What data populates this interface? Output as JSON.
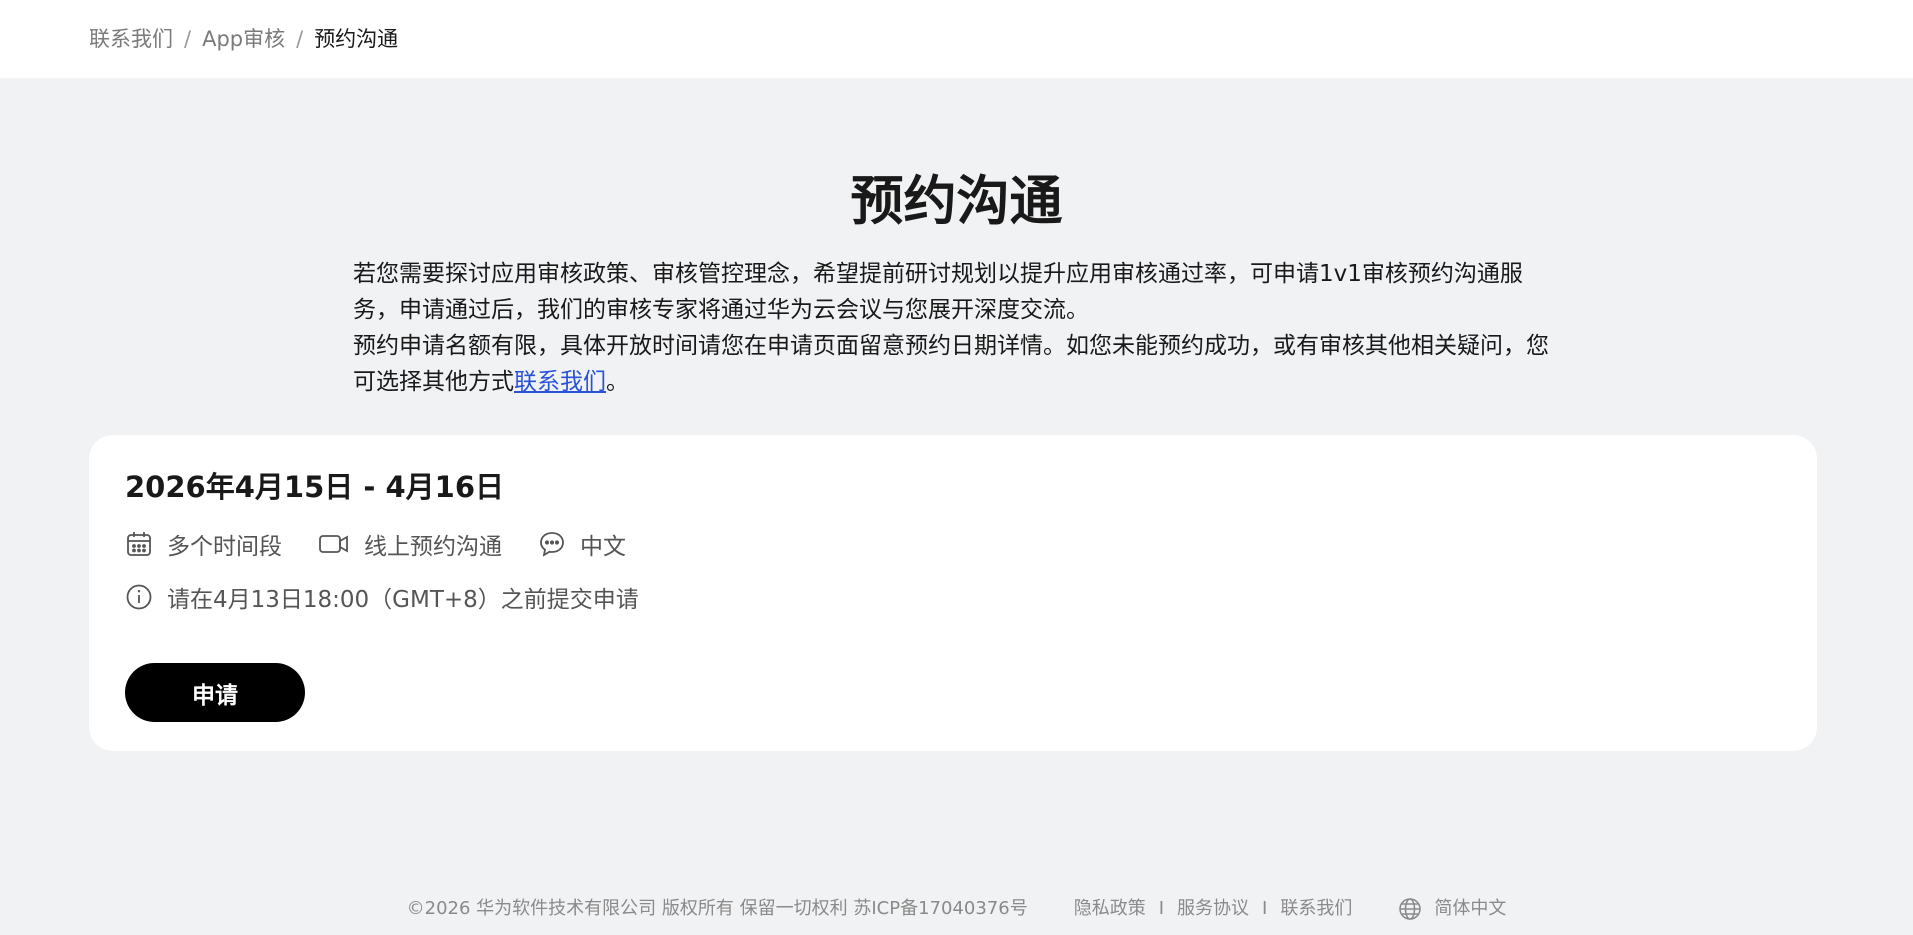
{
  "breadcrumb": {
    "items": [
      "联系我们",
      "App审核"
    ],
    "separator": "/",
    "current": "预约沟通"
  },
  "page": {
    "title": "预约沟通",
    "intro_line1": "若您需要探讨应用审核政策、审核管控理念，希望提前研讨规划以提升应用审核通过率，可申请1v1审核预约沟通服务，申请通过后，我们的审核专家将通过华为云会议与您展开深度交流。",
    "intro_line2_prefix": "预约申请名额有限，具体开放时间请您在申请页面留意预约日期详情。如您未能预约成功，或有审核其他相关疑问，您可选择其他方式",
    "intro_link": "联系我们",
    "intro_line2_suffix": "。"
  },
  "card": {
    "date_range": "2026年4月15日 - 4月16日",
    "meta": [
      {
        "icon": "calendar-icon",
        "text": "多个时间段"
      },
      {
        "icon": "video-camera-icon",
        "text": "线上预约沟通"
      },
      {
        "icon": "chat-bubble-icon",
        "text": "中文"
      }
    ],
    "deadline_icon": "info-icon",
    "deadline": "请在4月13日18:00（GMT+8）之前提交申请",
    "apply_label": "申请"
  },
  "footer": {
    "copyright": "©2026 华为软件技术有限公司 版权所有 保留一切权利 苏ICP备17040376号",
    "links": [
      "隐私政策",
      "服务协议",
      "联系我们"
    ],
    "separator": "I",
    "language_icon": "globe-icon",
    "language": "简体中文"
  },
  "colors": {
    "page_bg": "#f1f2f4",
    "link": "#2a52d6",
    "button_bg": "#000000"
  }
}
